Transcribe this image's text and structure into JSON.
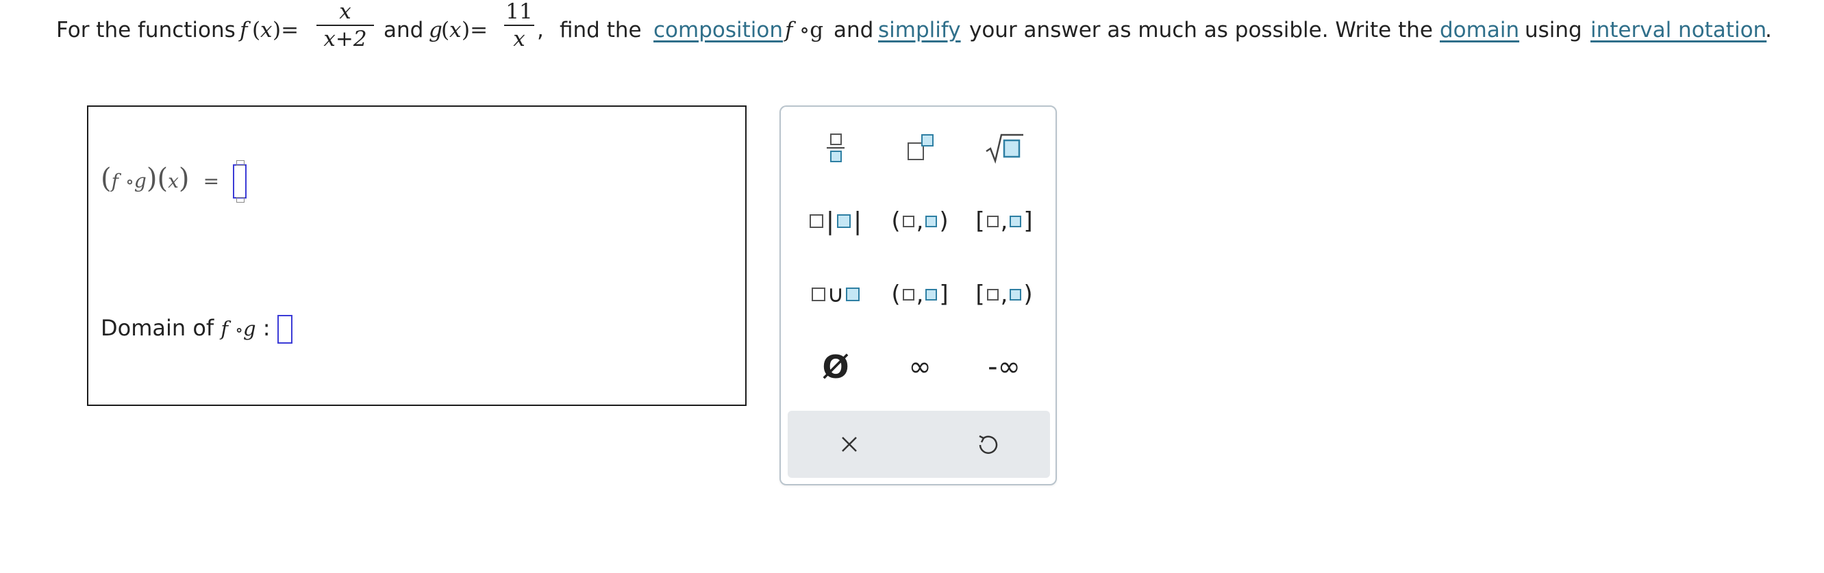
{
  "question": {
    "prefix": "For the functions",
    "f_name": "f",
    "paren_open": "(",
    "x_var": "x",
    "paren_close": ")=",
    "f_num": "x",
    "f_den": "x+2",
    "and": "and",
    "g_name": "g",
    "g_num": "11",
    "g_den": "x",
    "comma": ",",
    "find": "find the",
    "composition_link": "composition",
    "fog_f": "f",
    "fog_g": "∘g",
    "and2": "and",
    "simplify_link": "simplify",
    "middle": "your answer as much as possible. Write the",
    "domain_link": "domain",
    "using": "using",
    "interval_link": "interval notation",
    "period": "."
  },
  "answer": {
    "composition_label_f": "f",
    "composition_label_circ": "∘",
    "composition_label_g": "g",
    "composition_label_x": "x",
    "equals": "=",
    "domain_label_text": "Domain of",
    "domain_label_f": "f",
    "domain_label_circ": "∘",
    "domain_label_g": "g",
    "domain_colon": ":"
  },
  "keypad": {
    "keys": [
      {
        "name": "fraction",
        "icon": "fraction-icon"
      },
      {
        "name": "superscript",
        "icon": "exponent-icon"
      },
      {
        "name": "square-root",
        "icon": "sqrt-icon"
      },
      {
        "name": "absolute-value",
        "icon": "absolute-value-icon"
      },
      {
        "name": "open-interval",
        "icon": "open-interval-icon"
      },
      {
        "name": "closed-interval",
        "icon": "closed-interval-icon"
      },
      {
        "name": "union",
        "icon": "union-icon"
      },
      {
        "name": "left-open-right-closed",
        "icon": "half-open-interval-icon"
      },
      {
        "name": "left-closed-right-open",
        "icon": "half-closed-interval-icon"
      },
      {
        "name": "empty-set",
        "icon": "empty-set-icon"
      },
      {
        "name": "infinity",
        "icon": "infinity-icon"
      },
      {
        "name": "negative-infinity",
        "icon": "negative-infinity-icon"
      }
    ],
    "union_symbol": "∪",
    "empty_set_symbol": "Ø",
    "infinity_symbol": "∞",
    "neg_infinity_symbol": "-∞",
    "clear": {
      "icon": "close-icon"
    },
    "undo": {
      "icon": "undo-icon"
    }
  },
  "colors": {
    "link": "#2f6f8a",
    "slot_border": "#3b3bd6",
    "keypad_box_fill": "#c5e7f5",
    "keypad_box_border": "#2e7fa3",
    "keypad_bar_bg": "#e6e9ec"
  }
}
